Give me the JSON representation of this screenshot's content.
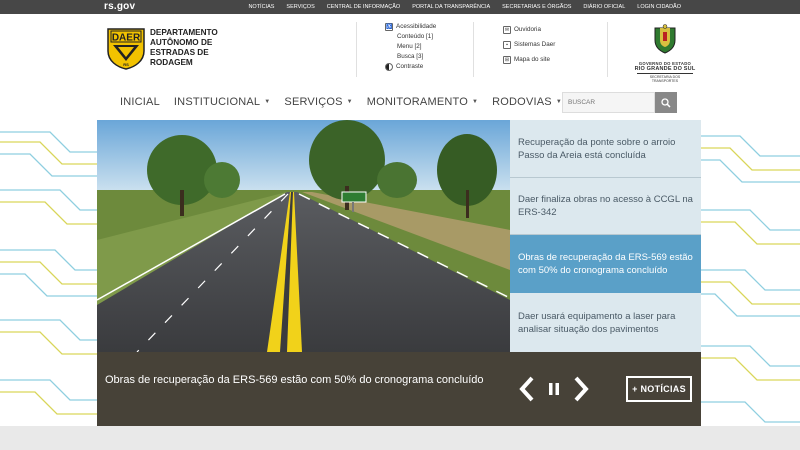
{
  "topbar": {
    "brand": "rs.gov",
    "links": [
      "NOTÍCIAS",
      "SERVIÇOS",
      "CENTRAL DE INFORMAÇÃO",
      "PORTAL DA TRANSPARÊNCIA",
      "SECRETARIAS E ÓRGÃOS",
      "DIÁRIO OFICIAL",
      "LOGIN CIDADÃO"
    ]
  },
  "header": {
    "logo_text": "DAER",
    "logo_sub": "RS",
    "org_line1": "DEPARTAMENTO",
    "org_line2": "AUTÔNOMO DE",
    "org_line3": "ESTRADAS DE",
    "org_line4": "RODAGEM",
    "accessibility": {
      "title": "Acessibilidade",
      "content": "Conteúdo [1]",
      "menu": "Menu [2]",
      "search": "Busca [3]",
      "contrast": "Contraste"
    },
    "links": {
      "ouvidoria": "Ouvidoria",
      "sistemas": "Sistemas Daer",
      "mapa": "Mapa do site"
    },
    "gov": {
      "line1": "GOVERNO DO ESTADO",
      "line2": "RIO GRANDE DO SUL",
      "line3": "SECRETARIA DOS TRANSPORTES"
    }
  },
  "nav": {
    "items": [
      {
        "label": "INICIAL",
        "has_caret": false
      },
      {
        "label": "INSTITUCIONAL",
        "has_caret": true
      },
      {
        "label": "SERVIÇOS",
        "has_caret": true
      },
      {
        "label": "MONITORAMENTO",
        "has_caret": true
      },
      {
        "label": "RODOVIAS",
        "has_caret": true
      }
    ],
    "search_placeholder": "BUSCAR"
  },
  "carousel": {
    "news": [
      {
        "title": "Recuperação da ponte sobre o arroio Passo da Areia está concluída",
        "active": false
      },
      {
        "title": "Daer finaliza obras no acesso à CCGL na ERS-342",
        "active": false
      },
      {
        "title": "Obras de recuperação da ERS-569 estão com 50% do cronograma concluído",
        "active": true
      },
      {
        "title": "Daer usará equipamento a laser para analisar situação dos pavimentos",
        "active": false
      }
    ],
    "caption": "Obras de recuperação da ERS-569 estão com 50% do cronograma concluído",
    "more_label": "+ NOTÍCIAS"
  },
  "colors": {
    "topbar": "#474747",
    "active_news": "#5aa0c8",
    "caption_bg": "#474238",
    "logo_yellow": "#f2c200"
  }
}
